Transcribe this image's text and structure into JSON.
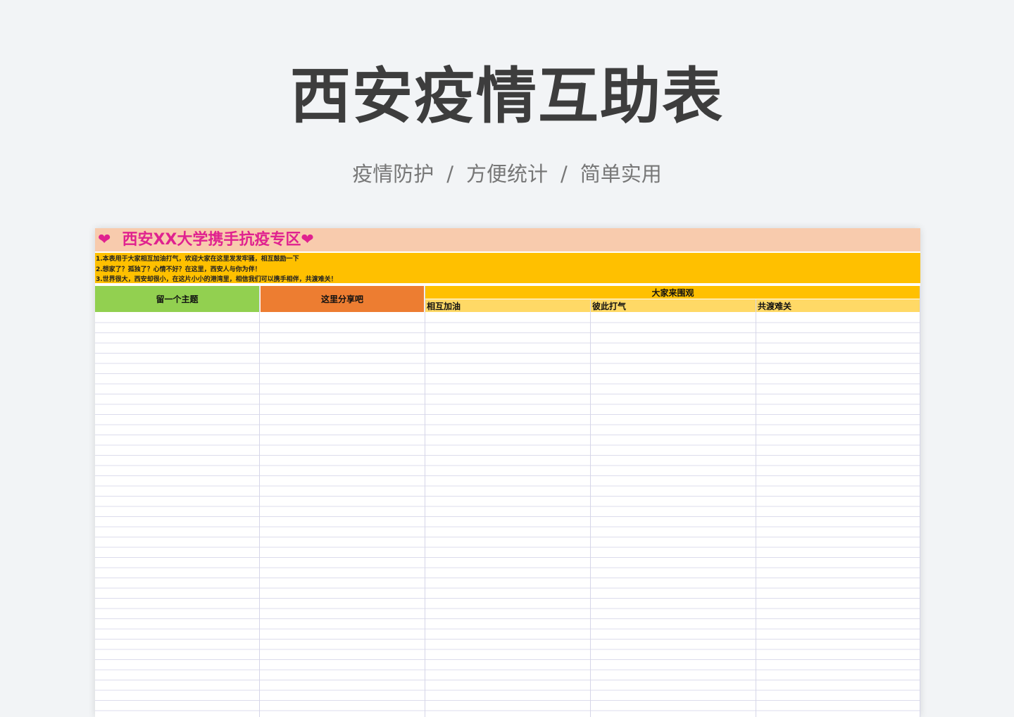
{
  "hero": {
    "title": "西安疫情互助表",
    "subtitle_parts": [
      "疫情防护",
      "方便统计",
      "简单实用"
    ],
    "separator": "/"
  },
  "sheet": {
    "banner": {
      "heart_left": "❤",
      "text": "西安XX大学携手抗疫专区",
      "heart_right": "❤"
    },
    "notes": [
      "1.本表用于大家相互加油打气，欢迎大家在这里发发牢骚，相互鼓励一下",
      "2.想家了？孤独了？心情不好？在这里，西安人与你为伴！",
      "3.世界很大，西安却很小，在这片小小的港湾里，相信我们可以携手相伴，共渡难关！"
    ],
    "headers": {
      "col1": "留一个主题",
      "col2": "这里分享吧",
      "group": "大家来围观",
      "sub1": "相互加油",
      "sub2": "彼此打气",
      "sub3": "共渡难关"
    }
  },
  "colors": {
    "banner_bg": "#f8cbad",
    "banner_text": "#e0228f",
    "notes_bg": "#ffc000",
    "col1_bg": "#92d050",
    "col2_bg": "#ed7d31",
    "group_bg": "#ffc000",
    "sub_bg": "#ffd966"
  }
}
